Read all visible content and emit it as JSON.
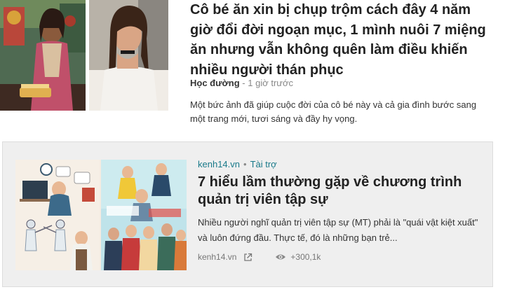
{
  "article1": {
    "title": "Cô bé ăn xin bị chụp trộm cách đây 4 năm giờ đổi đời ngoạn mục, 1 mình nuôi 7 miệng ăn nhưng vẫn không quên làm điều khiến nhiều người thán phục",
    "source": "Học đường",
    "separator": "-",
    "time": "1 giờ trước",
    "description": "Một bức ảnh đã giúp cuộc đời của cô bé này và cả gia đình bước sang một trang mới, tươi sáng và đầy hy vọng."
  },
  "sponsored": {
    "domain": "kenh14.vn",
    "dot": "•",
    "tag": "Tài trợ",
    "title": "7 hiểu lầm thường gặp về chương trình quản trị viên tập sự",
    "description": "Nhiều người nghĩ quản trị viên tập sự (MT) phải là \"quái vật kiệt xuất\" và luôn đứng đầu. Thực tế, đó là những bạn trẻ...",
    "footer_source": "kenh14.vn",
    "views": "+300,1k",
    "external_icon": "external-link-icon",
    "views_icon": "eye-icon"
  },
  "colors": {
    "accent": "#1a7a8a",
    "card_background": "#efefef",
    "title_text": "#222222",
    "meta_text": "#888888"
  }
}
